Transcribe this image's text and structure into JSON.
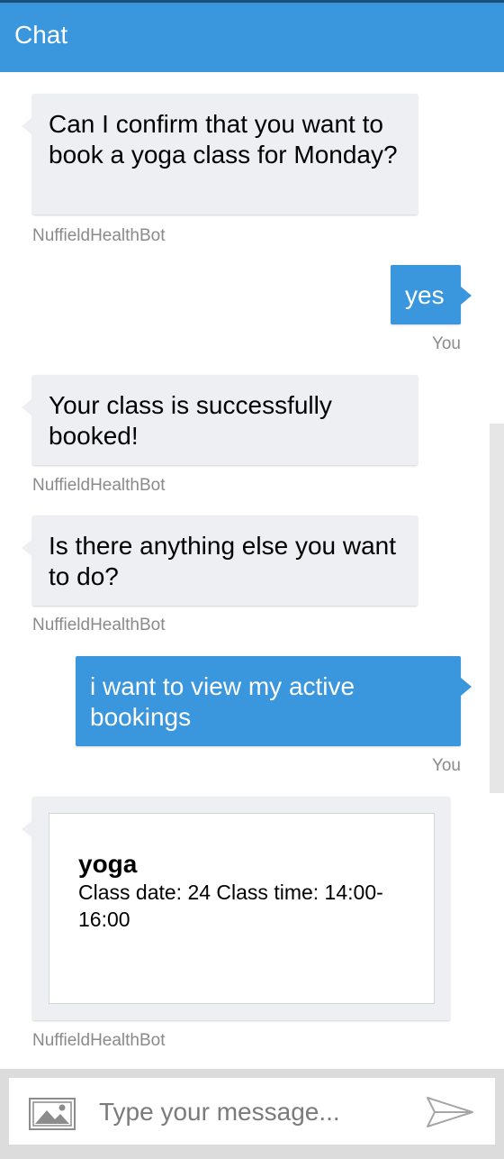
{
  "header": {
    "title": "Chat"
  },
  "messages": [
    {
      "text": "Can I confirm that you want to book a yoga class for Monday?",
      "sender": "NuffieldHealthBot"
    },
    {
      "text": "yes",
      "sender": "You"
    },
    {
      "text": "Your class is successfully booked!",
      "sender": "NuffieldHealthBot"
    },
    {
      "text": "Is there anything else you want to do?",
      "sender": "NuffieldHealthBot"
    },
    {
      "text": "i want to view my active bookings",
      "sender": "You"
    },
    {
      "card": {
        "title": "yoga",
        "text": "Class date: 24 Class time: 14:00-16:00"
      },
      "sender": "NuffieldHealthBot"
    }
  ],
  "composer": {
    "placeholder": "Type your message...",
    "upload_icon": "image-icon",
    "send_icon": "send-icon"
  },
  "colors": {
    "accent": "#3a96dd",
    "bot_bubble": "#edeff2",
    "sender_text": "#8a8a8a"
  }
}
